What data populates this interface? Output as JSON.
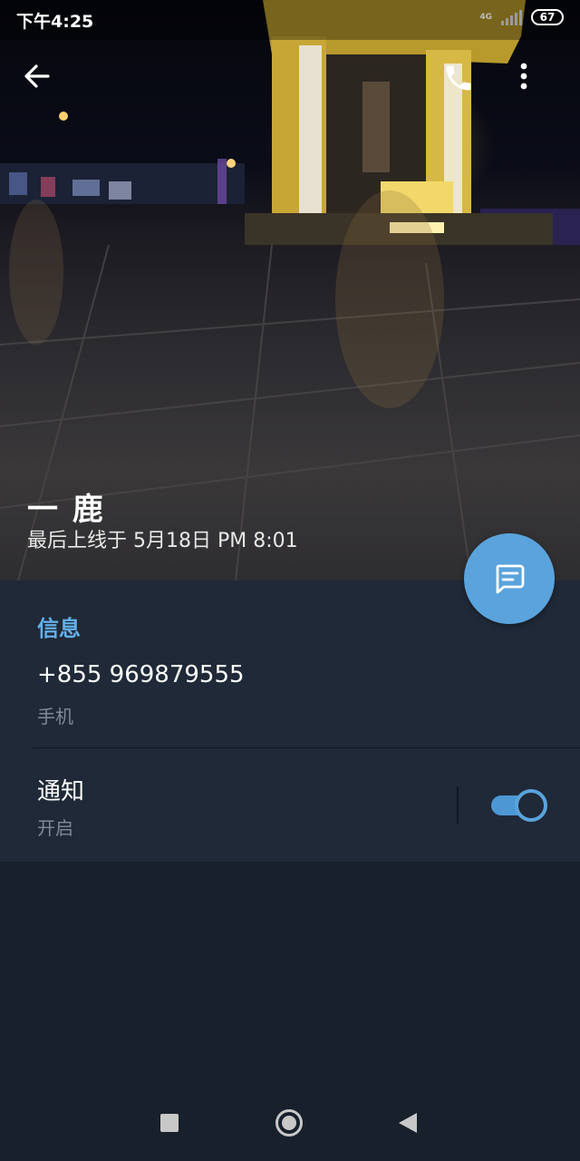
{
  "status_bar": {
    "time": "下午4:25",
    "network": "4G",
    "battery": "67"
  },
  "header": {
    "back_icon": "arrow-left-icon",
    "call_icon": "phone-icon",
    "more_icon": "more-vertical-icon"
  },
  "profile": {
    "name": "一 鹿",
    "last_seen": "最后上线于 5月18日 PM 8:01",
    "message_icon": "message-icon"
  },
  "info": {
    "section_title": "信息",
    "phone": "+855 969879555",
    "phone_label": "手机",
    "notifications_title": "通知",
    "notifications_status": "开启",
    "notifications_enabled": true
  },
  "nav_bar": {
    "recents_icon": "square-icon",
    "home_icon": "circle-icon",
    "back_icon": "triangle-back-icon"
  },
  "colors": {
    "accent": "#5aa3dc",
    "card_bg": "#1f2937",
    "page_bg": "#17202b",
    "secondary_text": "#7f8a96"
  }
}
